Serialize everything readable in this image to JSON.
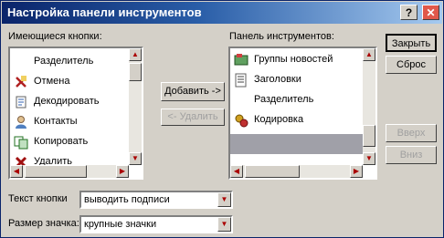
{
  "window": {
    "title": "Настройка панели инструментов",
    "help": "?",
    "close": "✕"
  },
  "available": {
    "label": "Имеющиеся кнопки:",
    "items": [
      {
        "label": "Разделитель",
        "icon": "separator"
      },
      {
        "label": "Отмена",
        "icon": "cancel-icon"
      },
      {
        "label": "Декодировать",
        "icon": "decode-icon"
      },
      {
        "label": "Контакты",
        "icon": "contacts-icon"
      },
      {
        "label": "Копировать",
        "icon": "copy-icon"
      },
      {
        "label": "Удалить",
        "icon": "delete-icon"
      }
    ]
  },
  "toolbar": {
    "label": "Панель инструментов:",
    "items": [
      {
        "label": "Группы новостей",
        "icon": "newsgroups-icon"
      },
      {
        "label": "Заголовки",
        "icon": "headers-icon"
      },
      {
        "label": "Разделитель",
        "icon": "separator"
      },
      {
        "label": "Кодировка",
        "icon": "encoding-icon"
      },
      {
        "label": "",
        "icon": "separator"
      }
    ]
  },
  "buttons": {
    "add": "Добавить ->",
    "remove": "<- Удалить",
    "close": "Закрыть",
    "reset": "Сброс",
    "up": "Вверх",
    "down": "Вниз"
  },
  "text_option": {
    "label": "Текст кнопки",
    "value": "выводить подписи"
  },
  "size_option": {
    "label": "Размер значка:",
    "value": "крупные значки"
  }
}
